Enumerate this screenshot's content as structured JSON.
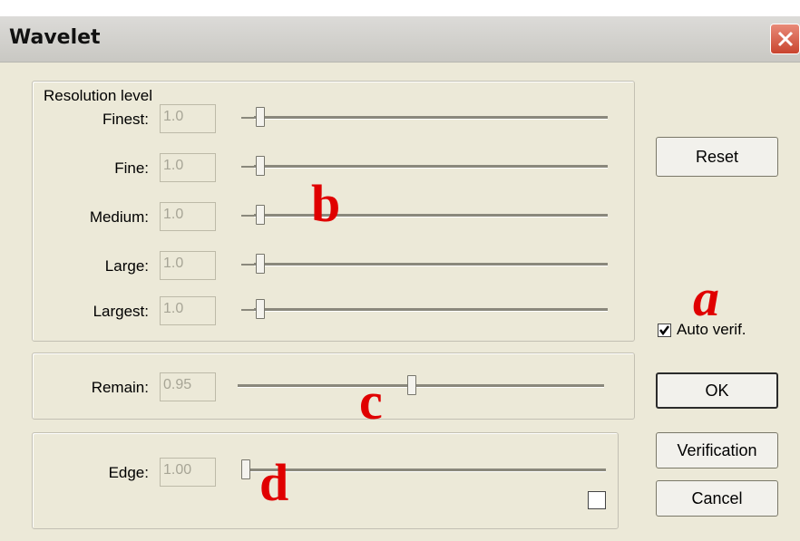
{
  "window": {
    "title": "Wavelet"
  },
  "resolution": {
    "legend": "Resolution level",
    "rows": [
      {
        "label": "Finest:",
        "value": "1.0"
      },
      {
        "label": "Fine:",
        "value": "1.0"
      },
      {
        "label": "Medium:",
        "value": "1.0"
      },
      {
        "label": "Large:",
        "value": "1.0"
      },
      {
        "label": "Largest:",
        "value": "1.0"
      }
    ]
  },
  "remain": {
    "label": "Remain:",
    "value": "0.95"
  },
  "edge": {
    "label": "Edge:",
    "value": "1.00",
    "checked": false
  },
  "buttons": {
    "reset": "Reset",
    "ok": "OK",
    "verification": "Verification",
    "cancel": "Cancel"
  },
  "auto_verif": {
    "label": "Auto verif.",
    "checked": true
  },
  "annotations": {
    "a": "a",
    "b": "b",
    "c": "c",
    "d": "d"
  },
  "colors": {
    "annotation": "#e00000",
    "dialog_bg": "#ece9d8"
  }
}
